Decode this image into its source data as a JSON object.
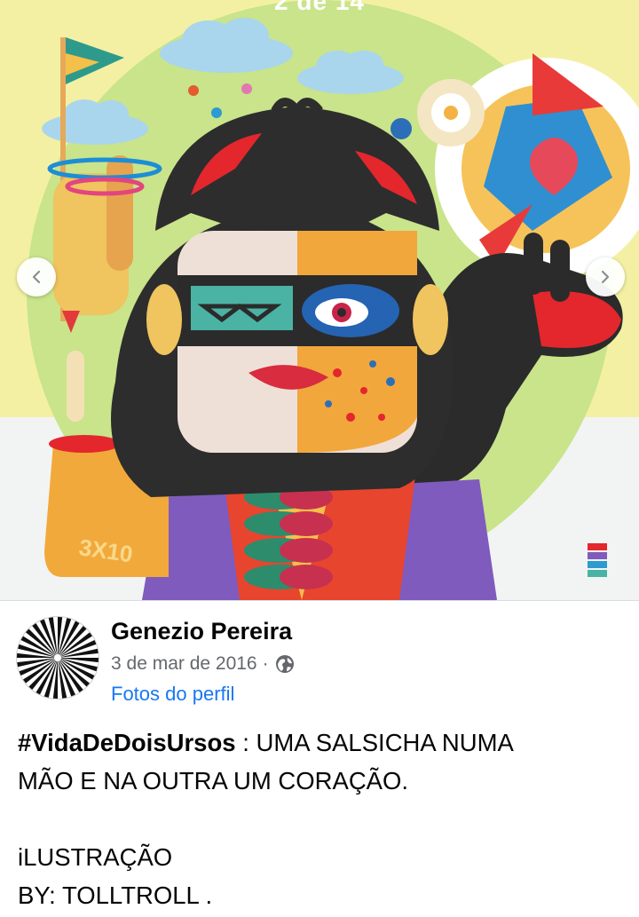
{
  "viewer": {
    "counter": "2 de 14",
    "prev_icon": "chevron-left-icon",
    "next_icon": "chevron-right-icon",
    "artwork_signature": "3X10"
  },
  "post": {
    "author": "Genezio Pereira",
    "date": "3 de mar de 2016",
    "separator": "·",
    "privacy_icon": "globe-icon",
    "album": "Fotos do perfil",
    "caption": {
      "hashtag": "#VidaDeDoisUrsos",
      "line1_rest": " : UMA SALSICHA NUMA",
      "line2": "MÃO E NA OUTRA UM CORAÇÃO.",
      "line3": "iLUSTRAÇÃO",
      "line4": "BY: TOLLTROLL ."
    }
  },
  "colors": {
    "link": "#1877f2",
    "secondary_text": "#65676b",
    "primary_text": "#050505"
  }
}
